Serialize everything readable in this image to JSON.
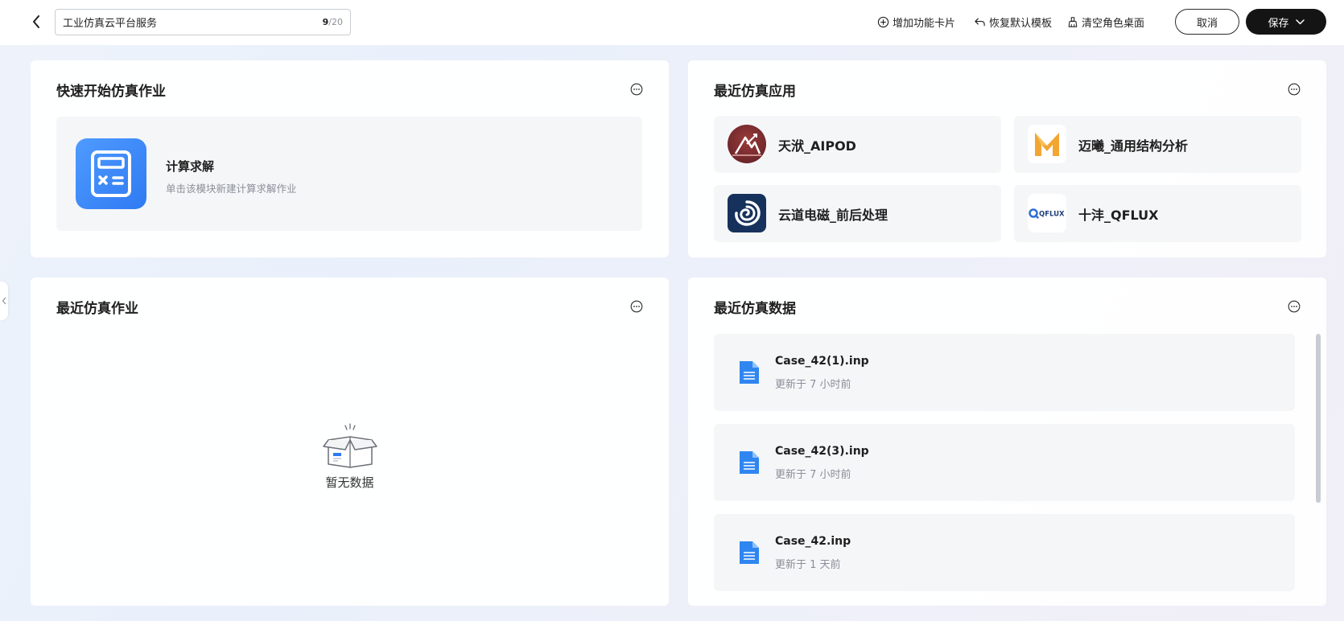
{
  "header": {
    "title_value": "工业仿真云平台服务",
    "counter_current": "9",
    "counter_max": "/20",
    "tools": {
      "add_card": "增加功能卡片",
      "restore_template": "恢复默认模板",
      "clear_desktop": "清空角色桌面"
    },
    "cancel_label": "取消",
    "save_label": "保存"
  },
  "quick_start": {
    "title": "快速开始仿真作业",
    "item": {
      "name": "计算求解",
      "desc": "单击该模块新建计算求解作业",
      "icon": "calculator-icon"
    }
  },
  "recent_apps": {
    "title": "最近仿真应用",
    "items": [
      {
        "name": "天洑_AIPOD",
        "icon": "aipod-logo"
      },
      {
        "name": "迈曦_通用结构分析",
        "icon": "maixi-logo"
      },
      {
        "name": "云道电磁_前后处理",
        "icon": "yundao-logo"
      },
      {
        "name": "十沣_QFLUX",
        "icon": "qflux-logo",
        "logo_text": "QFLUX"
      }
    ]
  },
  "recent_jobs": {
    "title": "最近仿真作业",
    "empty_text": "暂无数据"
  },
  "recent_data": {
    "title": "最近仿真数据",
    "items": [
      {
        "name": "Case_42(1).inp",
        "time": "更新于 7 小时前"
      },
      {
        "name": "Case_42(3).inp",
        "time": "更新于 7 小时前"
      },
      {
        "name": "Case_42.inp",
        "time": "更新于 1 天前"
      }
    ]
  },
  "colors": {
    "accent_blue": "#2f7af2",
    "save_button": "#141414",
    "tile_bg": "#f5f6f8"
  }
}
